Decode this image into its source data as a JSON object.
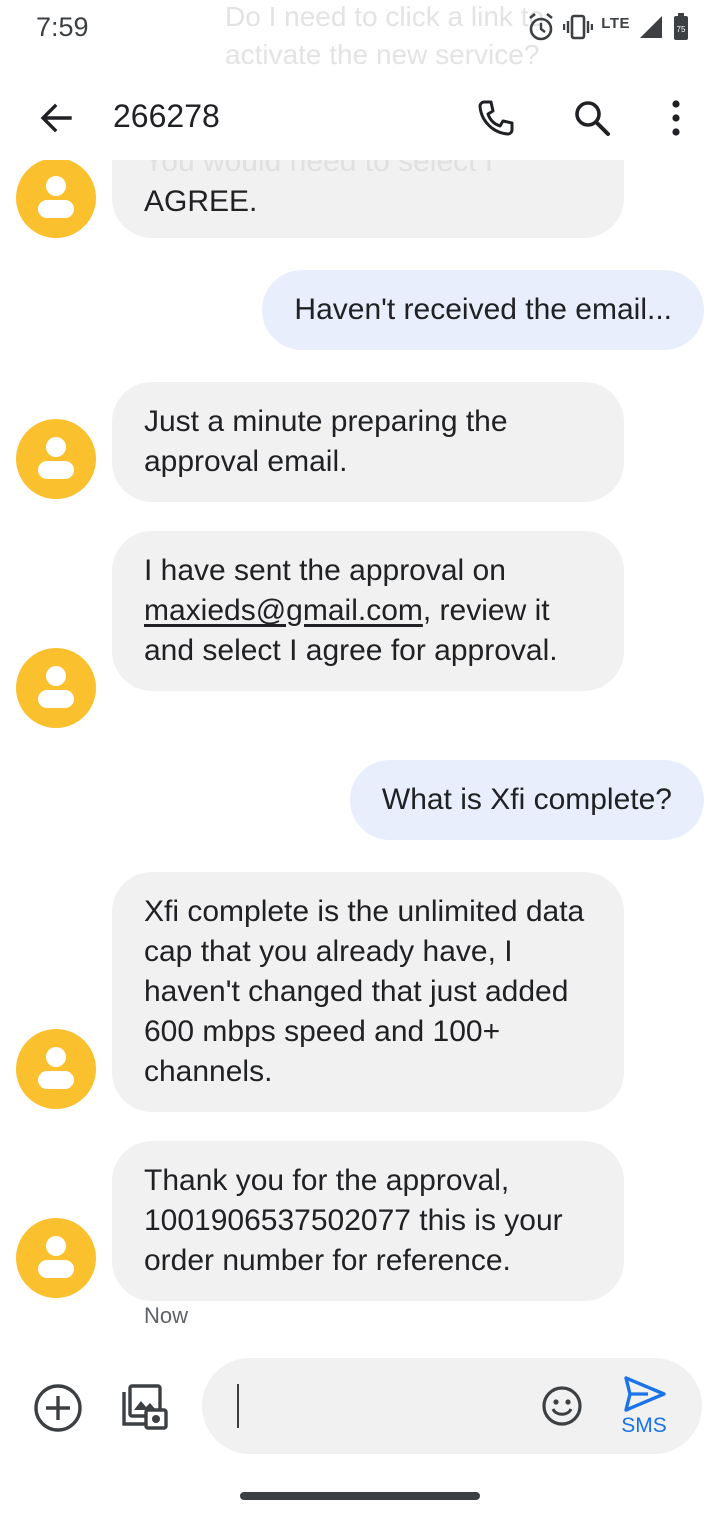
{
  "status_bar": {
    "time": "7:59",
    "network": "LTE",
    "battery_level": "75",
    "icons": [
      "alarm-icon",
      "vibrate-icon",
      "signal-icon",
      "battery-icon"
    ]
  },
  "notification_ghost": {
    "text": "Do I need to click a link to activate the new service?"
  },
  "toolbar": {
    "title": "266278",
    "icons": [
      "back-arrow-icon",
      "phone-icon",
      "search-icon",
      "more-vert-icon"
    ]
  },
  "messages": [
    {
      "direction": "incoming",
      "ghost_text": "You would need to select I",
      "text": "AGREE."
    },
    {
      "direction": "outgoing",
      "text": "Haven't received the email..."
    },
    {
      "direction": "incoming",
      "text": "Just a minute preparing the approval email."
    },
    {
      "direction": "incoming",
      "text_before_link": "I have sent the approval on ",
      "link": "maxieds@gmail.com",
      "text_after_link": ", review it and select I agree for approval."
    },
    {
      "direction": "outgoing",
      "text": "What is Xfi complete?"
    },
    {
      "direction": "incoming",
      "text": "Xfi complete is the unlimited data cap that you already have, I haven't changed that just added 600 mbps speed and 100+ channels."
    },
    {
      "direction": "incoming",
      "text": "Thank you for the approval, 1001906537502077 this is your order number for reference."
    }
  ],
  "last_timestamp": "Now",
  "compose": {
    "value": "",
    "placeholder": "",
    "send_label": "SMS"
  },
  "colors": {
    "avatar": "#fbc02d",
    "incoming_bubble": "#f1f1f1",
    "outgoing_bubble": "#e8eefb",
    "accent": "#1a73e8"
  }
}
